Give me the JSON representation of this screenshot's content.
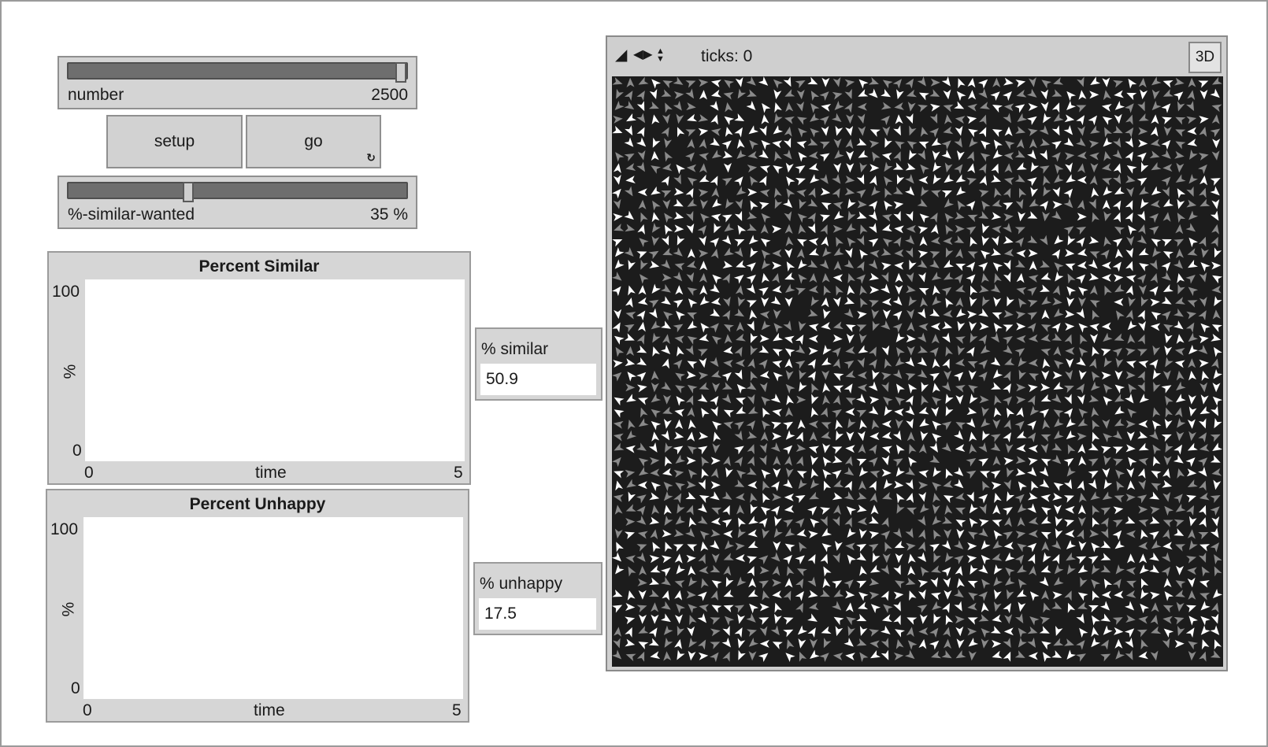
{
  "controls": {
    "number_slider": {
      "label": "number",
      "value": "2500",
      "fraction": 1.0
    },
    "setup_label": "setup",
    "go_label": "go",
    "go_forever_icon": "forever-icon",
    "similar_slider": {
      "label": "%-similar-wanted",
      "value": "35 %",
      "fraction": 0.35
    }
  },
  "plots": [
    {
      "title": "Percent Similar",
      "ymax": "100",
      "ymin": "0",
      "ylabel": "%",
      "xmin": "0",
      "xmax": "5",
      "xlabel": "time"
    },
    {
      "title": "Percent Unhappy",
      "ymax": "100",
      "ymin": "0",
      "ylabel": "%",
      "xmin": "0",
      "xmax": "5",
      "xlabel": "time"
    }
  ],
  "monitors": [
    {
      "label": "% similar",
      "value": "50.9"
    },
    {
      "label": "% unhappy",
      "value": "17.5"
    }
  ],
  "view": {
    "ticks": "ticks: 0",
    "three_d_label": "3D",
    "icons": [
      "edit-icon",
      "left-right-arrows-icon",
      "up-down-arrows-icon"
    ],
    "turtle_colors": {
      "group_a": "#ffffff",
      "group_b": "#8a8a8a",
      "background": "#1c1c1c"
    }
  }
}
